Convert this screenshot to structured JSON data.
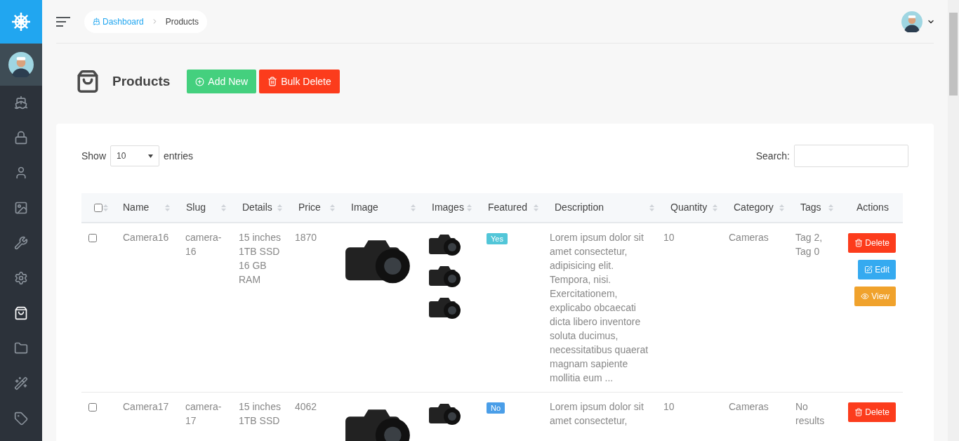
{
  "sidebar": {
    "items": [
      {
        "selected": false
      },
      {
        "selected": false
      },
      {
        "selected": false
      },
      {
        "selected": false
      },
      {
        "selected": false
      },
      {
        "selected": false
      },
      {
        "selected": true
      },
      {
        "selected": false
      },
      {
        "selected": false
      },
      {
        "selected": false
      }
    ]
  },
  "breadcrumb": [
    {
      "label": "Dashboard",
      "link": true
    },
    {
      "label": "Products",
      "link": false
    }
  ],
  "page": {
    "title": "Products",
    "buttons": [
      {
        "label": "Add New",
        "kind": "add"
      },
      {
        "label": "Bulk Delete",
        "kind": "delete"
      }
    ]
  },
  "table_controls": {
    "show_label": "Show",
    "entries_value": "10",
    "entries_label": "entries",
    "search_label": "Search:"
  },
  "table": {
    "select_all_checked": false,
    "columns": [
      {
        "label": "Name",
        "sortable": true
      },
      {
        "label": "Slug",
        "sortable": true
      },
      {
        "label": "Details",
        "sortable": true
      },
      {
        "label": "Price",
        "sortable": true
      },
      {
        "label": "Image",
        "sortable": true
      },
      {
        "label": "Images",
        "sortable": true
      },
      {
        "label": "Featured",
        "sortable": true
      },
      {
        "label": "Description",
        "sortable": true
      },
      {
        "label": "Quantity",
        "sortable": true
      },
      {
        "label": "Category",
        "sortable": true
      },
      {
        "label": "Tags",
        "sortable": true
      },
      {
        "label": "Actions",
        "sortable": false
      }
    ],
    "rows": [
      {
        "checked": false,
        "name": "Camera16",
        "slug": "camera-16",
        "details": [
          "15 inches",
          "1TB SSD",
          "16 GB",
          "RAM"
        ],
        "price": "1870",
        "images": [
          {
            "kind": "camera"
          },
          {
            "kind": "camera"
          },
          {
            "kind": "camera"
          }
        ],
        "featured": true,
        "featured_label": "Yes",
        "description": "Lorem ipsum dolor sit amet consectetur, adipisicing elit. Tempora, nisi. Exercitationem, explicabo obcaecati dicta libero inventore soluta ducimus, necessitatibus quaerat magnam sapiente mollitia eum ...",
        "quantity": "10",
        "category": "Cameras",
        "tags": "Tag 2, Tag 0",
        "actions": [
          {
            "label": "Delete",
            "kind": "delete"
          },
          {
            "label": "Edit",
            "kind": "edit"
          },
          {
            "label": "View",
            "kind": "view"
          }
        ]
      },
      {
        "checked": false,
        "name": "Camera17",
        "slug": "camera-17",
        "details": [
          "15 inches",
          "1TB SSD"
        ],
        "price": "4062",
        "images": [
          {
            "kind": "camera"
          }
        ],
        "featured": false,
        "featured_label": "No",
        "description": "Lorem ipsum dolor sit amet consectetur,",
        "quantity": "10",
        "category": "Cameras",
        "tags": "No results",
        "actions": [
          {
            "label": "Delete",
            "kind": "delete"
          }
        ]
      }
    ]
  }
}
